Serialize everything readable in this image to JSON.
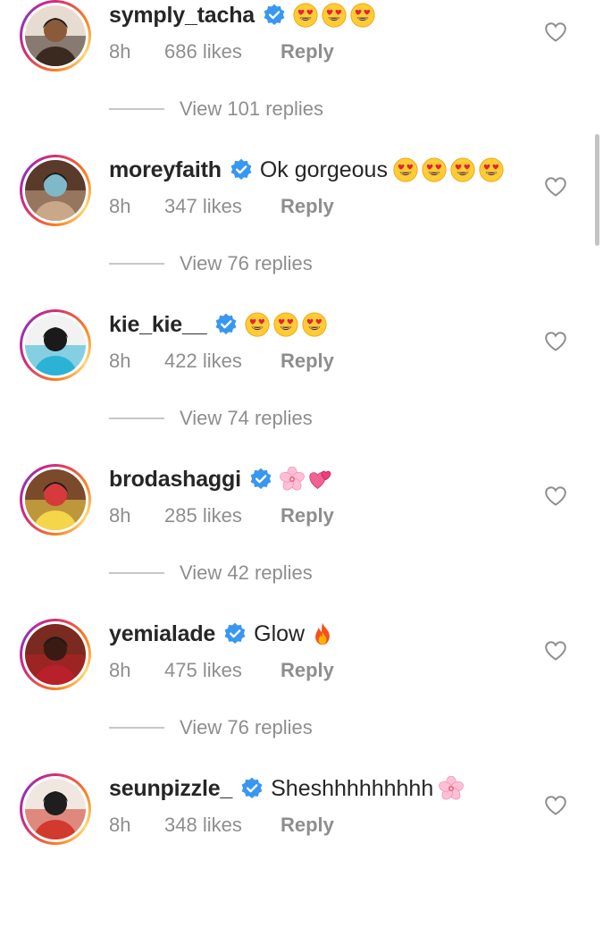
{
  "comments": [
    {
      "username": "symply_tacha",
      "text": "",
      "emoji": [
        "heart-eyes",
        "heart-eyes",
        "heart-eyes"
      ],
      "time": "8h",
      "likes": "686 likes",
      "reply_label": "Reply",
      "view_replies": "View 101 replies",
      "avatar_colors": [
        "#3a2a1f",
        "#8a5a3a",
        "#e6dcd2"
      ]
    },
    {
      "username": "moreyfaith",
      "text": "Ok gorgeous",
      "emoji": [
        "heart-eyes",
        "heart-eyes",
        "heart-eyes",
        "heart-eyes"
      ],
      "time": "8h",
      "likes": "347 likes",
      "reply_label": "Reply",
      "view_replies": "View 76 replies",
      "avatar_colors": [
        "#c9a88a",
        "#7fb8c8",
        "#5a3a2a"
      ]
    },
    {
      "username": "kie_kie__",
      "text": "",
      "emoji": [
        "heart-eyes",
        "heart-eyes",
        "heart-eyes"
      ],
      "time": "8h",
      "likes": "422 likes",
      "reply_label": "Reply",
      "view_replies": "View 74 replies",
      "avatar_colors": [
        "#2bb3d6",
        "#1a1a1a",
        "#f2f2f2"
      ]
    },
    {
      "username": "brodashaggi",
      "text": "",
      "emoji": [
        "cherry-blossom",
        "two-hearts"
      ],
      "time": "8h",
      "likes": "285 likes",
      "reply_label": "Reply",
      "view_replies": "View 42 replies",
      "avatar_colors": [
        "#f5d64a",
        "#d63a3a",
        "#7a4a2a"
      ]
    },
    {
      "username": "yemialade",
      "text": "Glow",
      "emoji": [
        "fire"
      ],
      "time": "8h",
      "likes": "475 likes",
      "reply_label": "Reply",
      "view_replies": "View 76 replies",
      "avatar_colors": [
        "#b8202a",
        "#3a1a12",
        "#7a2a1e"
      ]
    },
    {
      "username": "seunpizzle_",
      "text": "Sheshhhhhhhhh",
      "emoji": [
        "cherry-blossom"
      ],
      "time": "8h",
      "likes": "348 likes",
      "reply_label": "Reply",
      "view_replies": "",
      "avatar_colors": [
        "#d23a2e",
        "#1e1e1e",
        "#f0e8e0"
      ]
    }
  ],
  "icons": {
    "verified": "verified-badge-icon",
    "like": "heart-outline-icon"
  },
  "colors": {
    "verified_blue": "#3897f0",
    "text_primary": "#262626",
    "text_secondary": "#8e8e8e"
  }
}
